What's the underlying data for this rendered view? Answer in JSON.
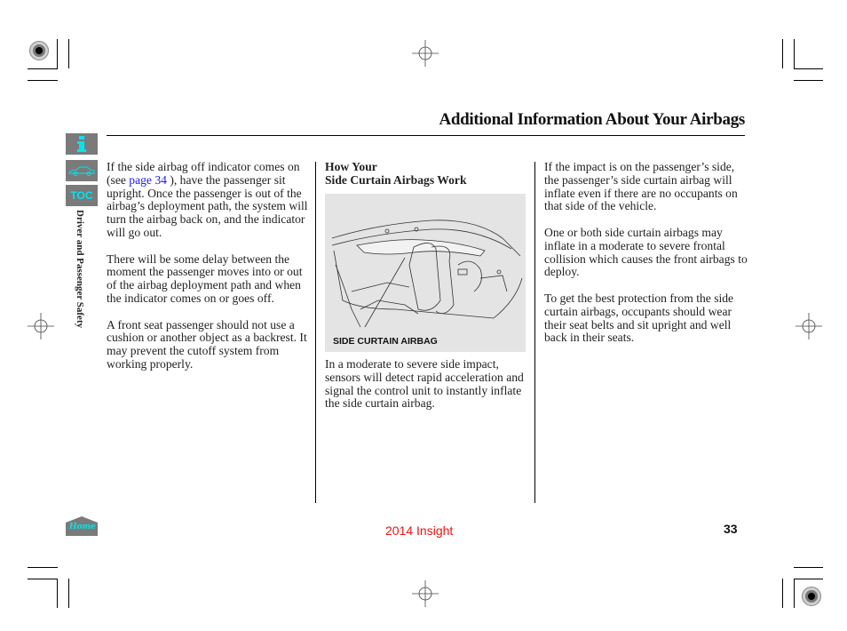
{
  "header": {
    "title": "Additional Information About Your Airbags"
  },
  "sidebar": {
    "info_button": {
      "icon": "info-icon",
      "label": "i"
    },
    "vehicle_button": {
      "icon": "car-icon"
    },
    "toc_button": {
      "label": "TOC"
    },
    "section_label": "Driver and Passenger Safety",
    "home_button": {
      "label": "Home"
    }
  },
  "columns": {
    "left": {
      "p1_before_link": "If the side airbag off indicator comes on (see ",
      "p1_link": "page 34",
      "p1_after_link": " ), have the passenger sit upright. Once the passenger is out of the airbag’s deployment path, the system will turn the airbag back on, and the indicator will go out.",
      "p2": "There will be some delay between the moment the passenger moves into or out of the airbag deployment path and when the indicator comes on or goes off.",
      "p3": "A front seat passenger should not use a cushion or another object as a backrest. It may prevent the cutoff system from working properly."
    },
    "middle": {
      "heading_line1": "How Your",
      "heading_line2": "Side Curtain Airbags Work",
      "figure_label": "SIDE CURTAIN AIRBAG",
      "p1": "In a moderate to severe side impact, sensors will detect rapid acceleration and signal the control unit to instantly inflate the side curtain airbag."
    },
    "right": {
      "p1": "If the impact is on the passenger’s side, the passenger’s side curtain airbag will inflate even if there are no occupants on that side of the vehicle.",
      "p2": "One or both side curtain airbags may inflate in a moderate to severe frontal collision which causes the front airbags to deploy.",
      "p3": "To get the best protection from the side curtain airbags, occupants should wear their seat belts and sit upright and well back in their seats."
    }
  },
  "footer": {
    "model": "2014 Insight",
    "page_number": "33"
  },
  "colors": {
    "link": "#1a1aff",
    "model_text": "#ee1111",
    "sidebar_button_bg": "#7a7a7a",
    "sidebar_icon": "#00e5ee",
    "figure_bg": "#e4e4e4"
  }
}
